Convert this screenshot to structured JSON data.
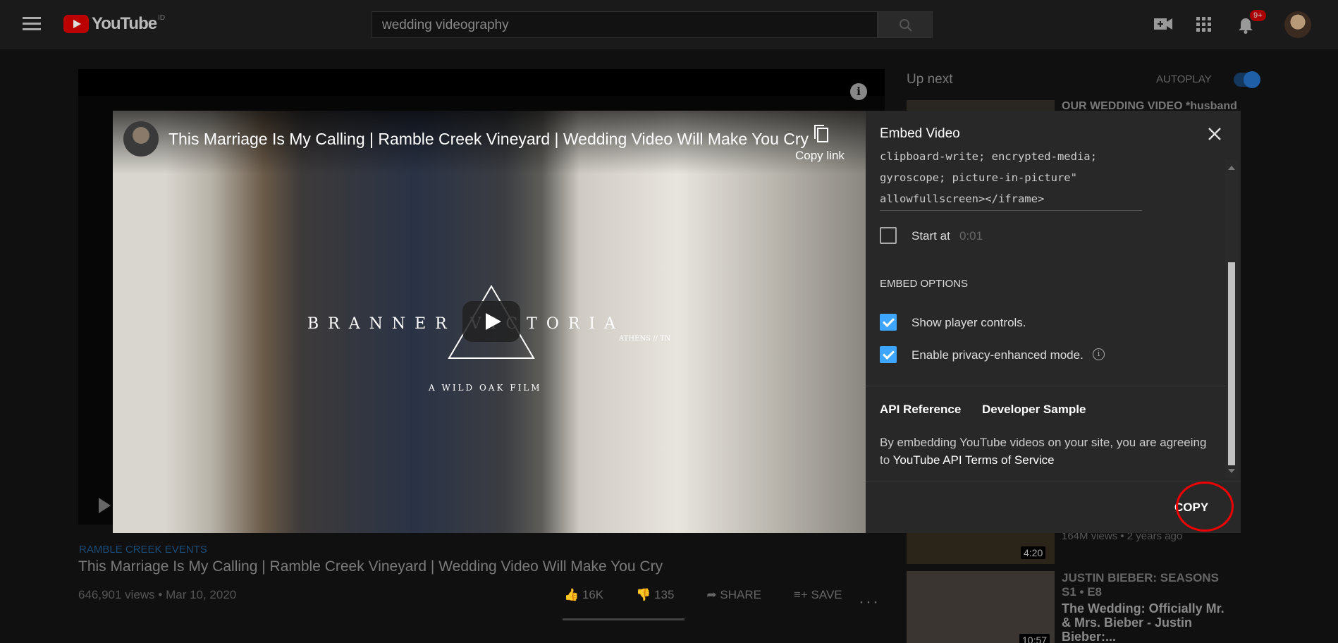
{
  "masthead": {
    "logo_text": "YouTube",
    "country_code": "ID",
    "search_value": "wedding videography",
    "notification_count": "9+"
  },
  "background_page": {
    "location": "RAMBLE CREEK EVENTS",
    "video_title": "This Marriage Is My Calling | Ramble Creek Vineyard | Wedding Video Will Make You Cry",
    "views_date": "646,901 views • Mar 10, 2020",
    "likes": "16K",
    "dislikes": "135",
    "share_label": "SHARE",
    "save_label": "SAVE",
    "up_next_label": "Up next",
    "autoplay_label": "AUTOPLAY",
    "side_items": [
      {
        "title": "OUR WEDDING VIDEO *husband"
      },
      {
        "duration": "4:20",
        "meta": "164M views • 2 years ago"
      },
      {
        "title": "JUSTIN BIEBER: SEASONS  S1 • E8"
      },
      {
        "title": "The Wedding: Officially Mr. & Mrs. Bieber - Justin Bieber:...",
        "duration": "10:57"
      }
    ]
  },
  "player": {
    "title": "This Marriage Is My Calling | Ramble Creek Vineyard | Wedding Video Will Make You Cry",
    "copy_link_label": "Copy link",
    "overlay_brand": "BRANNER   VICTORIA",
    "overlay_city": "ATHENS // TN",
    "overlay_film": "A WILD OAK FILM"
  },
  "embed": {
    "title": "Embed Video",
    "code_lines": [
      "clipboard-write; encrypted-media;",
      "gyroscope; picture-in-picture\"",
      "allowfullscreen></iframe>"
    ],
    "start_at_label": "Start at",
    "start_at_value": "0:01",
    "embed_options_heading": "EMBED OPTIONS",
    "show_controls_label": "Show player controls.",
    "privacy_mode_label": "Enable privacy-enhanced mode.",
    "api_reference_label": "API Reference",
    "developer_sample_label": "Developer Sample",
    "legal_text": "By embedding YouTube videos on your site, you are agreeing to",
    "legal_link": "YouTube API Terms of Service",
    "copy_button_label": "COPY"
  },
  "colors": {
    "accent_blue": "#3ea6ff",
    "highlight_circle": "#e00000",
    "panel_bg": "#282828"
  }
}
